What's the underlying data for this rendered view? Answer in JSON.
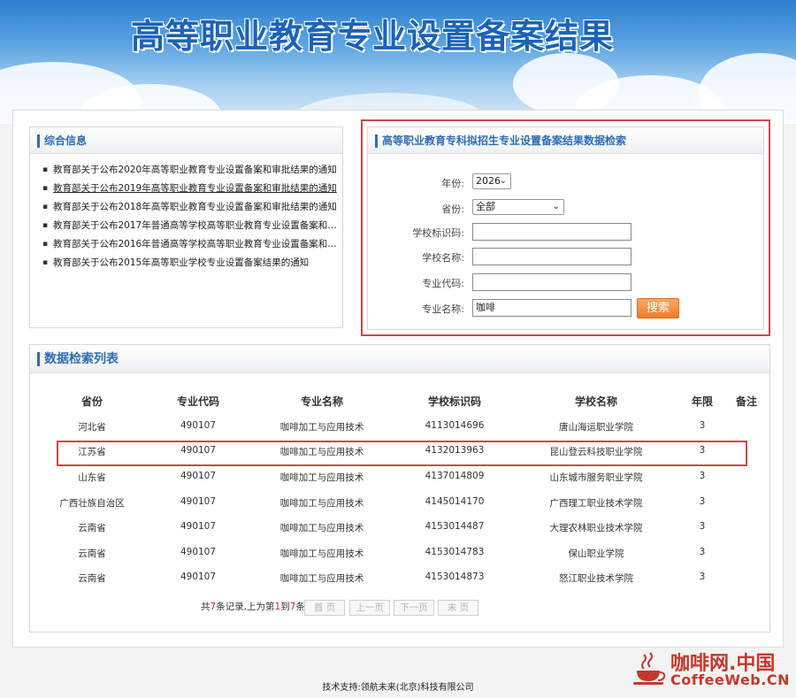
{
  "banner": {
    "title": "高等职业教育专业设置备案结果"
  },
  "info": {
    "title": "综合信息",
    "items": [
      "教育部关于公布2020年高等职业教育专业设置备案和审批结果的通知",
      "教育部关于公布2019年高等职业教育专业设置备案和审批结果的通知",
      "教育部关于公布2018年高等职业教育专业设置备案和审批结果的通知",
      "教育部关于公布2017年普通高等学校高等职业教育专业设置备案和审...",
      "教育部关于公布2016年普通高等学校高等职业教育专业设置备案和审...",
      "教育部关于公布2015年高等职业学校专业设置备案结果的通知"
    ]
  },
  "search": {
    "title": "高等职业教育专科拟招生专业设置备案结果数据检索",
    "year_label": "年份:",
    "year_value": "2026",
    "province_label": "省份:",
    "province_value": "全部",
    "school_code_label": "学校标识码:",
    "school_code_value": "",
    "school_name_label": "学校名称:",
    "school_name_value": "",
    "major_code_label": "专业代码:",
    "major_code_value": "",
    "major_name_label": "专业名称:",
    "major_name_value": "咖啡",
    "search_button": "搜索"
  },
  "results": {
    "title": "数据检索列表",
    "columns": [
      "省份",
      "专业代码",
      "专业名称",
      "学校标识码",
      "学校名称",
      "年限",
      "备注"
    ],
    "rows": [
      [
        "河北省",
        "490107",
        "咖啡加工与应用技术",
        "4113014696",
        "唐山海运职业学院",
        "3",
        ""
      ],
      [
        "江苏省",
        "490107",
        "咖啡加工与应用技术",
        "4132013963",
        "昆山登云科技职业学院",
        "3",
        ""
      ],
      [
        "山东省",
        "490107",
        "咖啡加工与应用技术",
        "4137014809",
        "山东城市服务职业学院",
        "3",
        ""
      ],
      [
        "广西壮族自治区",
        "490107",
        "咖啡加工与应用技术",
        "4145014170",
        "广西理工职业技术学院",
        "3",
        ""
      ],
      [
        "云南省",
        "490107",
        "咖啡加工与应用技术",
        "4153014487",
        "大理农林职业技术学院",
        "3",
        ""
      ],
      [
        "云南省",
        "490107",
        "咖啡加工与应用技术",
        "4153014783",
        "保山职业学院",
        "3",
        ""
      ],
      [
        "云南省",
        "490107",
        "咖啡加工与应用技术",
        "4153014873",
        "怒江职业技术学院",
        "3",
        ""
      ]
    ],
    "pager": {
      "prefix": "共",
      "total": "7",
      "middle": "条记录,上为第",
      "from": "1",
      "to_word": "到",
      "to": "7",
      "suffix": "条",
      "first": "首 页",
      "prev": "上一页",
      "next": "下一页",
      "last": "末 页"
    }
  },
  "footer": {
    "text": "技术支持:领航未来(北京)科技有限公司"
  },
  "watermark": {
    "cn": "咖啡网.中国",
    "en": "CoffeeWeb.CN"
  },
  "colors": {
    "accent": "#2f6db5",
    "highlight": "#c9494d",
    "button": "#ef7d27",
    "brand": "#c2392b"
  }
}
